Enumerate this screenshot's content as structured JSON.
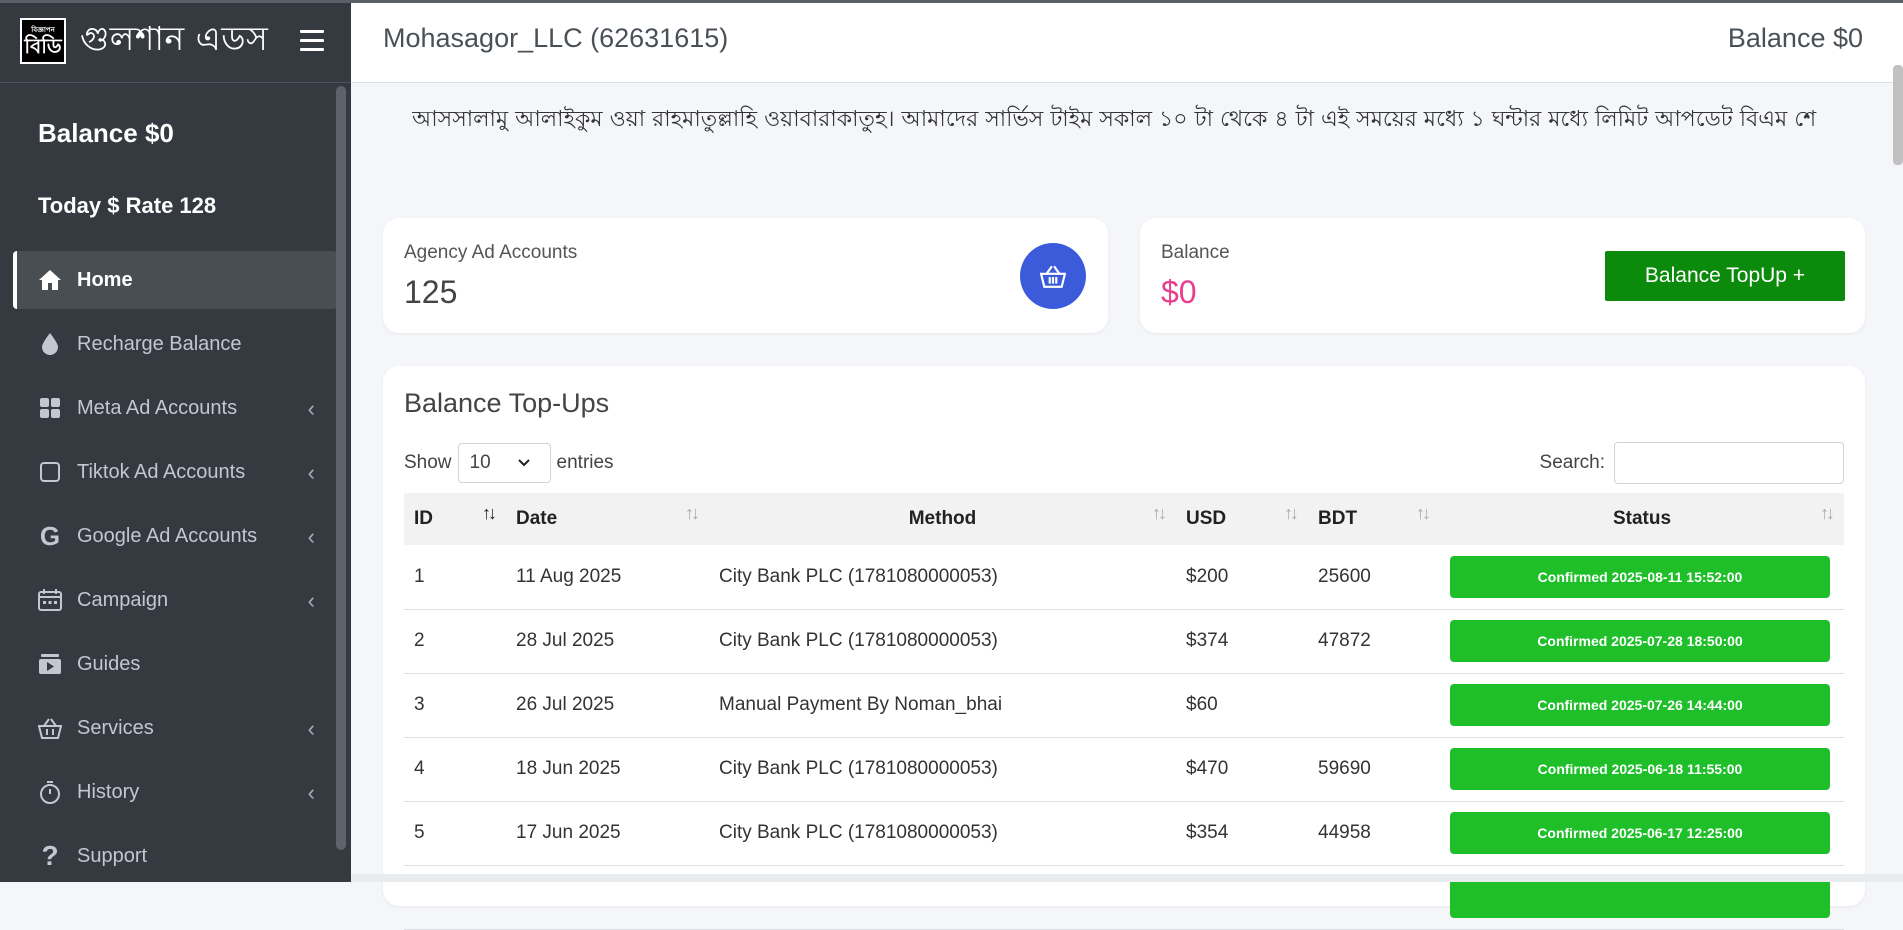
{
  "brand": {
    "logo_small": "বিজ্ঞাপন",
    "logo_big": "বিডি",
    "name": "গুলশান এডস"
  },
  "sidebar": {
    "balance": "Balance $0",
    "rate": "Today $ Rate 128",
    "items": [
      {
        "label": "Home",
        "icon": "home-icon",
        "active": true
      },
      {
        "label": "Recharge Balance",
        "icon": "drop-icon"
      },
      {
        "label": "Meta Ad Accounts",
        "icon": "grid-icon"
      },
      {
        "label": "Tiktok Ad Accounts",
        "icon": "square-icon"
      },
      {
        "label": "Google Ad Accounts",
        "icon": "google-icon"
      },
      {
        "label": "Campaign",
        "icon": "calendar-icon"
      },
      {
        "label": "Guides",
        "icon": "video-icon"
      },
      {
        "label": "Services",
        "icon": "basket-icon"
      },
      {
        "label": "History",
        "icon": "stopwatch-icon"
      },
      {
        "label": "Support",
        "icon": "question-icon"
      }
    ]
  },
  "header": {
    "title": "Mohasagor_LLC (62631615)",
    "balance": "Balance $0"
  },
  "notice": "আসসালামু আলাইকুম ওয়া রাহমাতুল্লাহি ওয়াবারাকাতুহ। আমাদের সার্ভিস টাইম সকাল ১০ টা থেকে ৪ টা এই সময়ের মধ্যে ১ ঘন্টার মধ্যে লিমিট আপডেট বিএম শে",
  "cards": {
    "accounts_label": "Agency Ad Accounts",
    "accounts_value": "125",
    "balance_label": "Balance",
    "balance_value": "$0",
    "topup_button": "Balance TopUp +"
  },
  "table": {
    "title": "Balance Top-Ups",
    "show_label": "Show",
    "entries_value": "10",
    "entries_label": "entries",
    "search_label": "Search:",
    "columns": [
      "ID",
      "Date",
      "Method",
      "USD",
      "BDT",
      "Status"
    ],
    "rows": [
      {
        "id": "1",
        "date": "11 Aug 2025",
        "method": "City Bank PLC (1781080000053)",
        "usd": "$200",
        "bdt": "25600",
        "status": "Confirmed 2025-08-11 15:52:00"
      },
      {
        "id": "2",
        "date": "28 Jul 2025",
        "method": "City Bank PLC (1781080000053)",
        "usd": "$374",
        "bdt": "47872",
        "status": "Confirmed 2025-07-28 18:50:00"
      },
      {
        "id": "3",
        "date": "26 Jul 2025",
        "method": "Manual Payment By Noman_bhai",
        "usd": "$60",
        "bdt": "",
        "status": "Confirmed 2025-07-26 14:44:00"
      },
      {
        "id": "4",
        "date": "18 Jun 2025",
        "method": "City Bank PLC (1781080000053)",
        "usd": "$470",
        "bdt": "59690",
        "status": "Confirmed 2025-06-18 11:55:00"
      },
      {
        "id": "5",
        "date": "17 Jun 2025",
        "method": "City Bank PLC (1781080000053)",
        "usd": "$354",
        "bdt": "44958",
        "status": "Confirmed 2025-06-17 12:25:00"
      }
    ]
  },
  "colors": {
    "sidebar_bg": "#343a40",
    "status_green": "#1fbf2a",
    "topup_green": "#0c8a0c",
    "basket_blue": "#3b5bdb",
    "balance_pink": "#e83e8c"
  }
}
